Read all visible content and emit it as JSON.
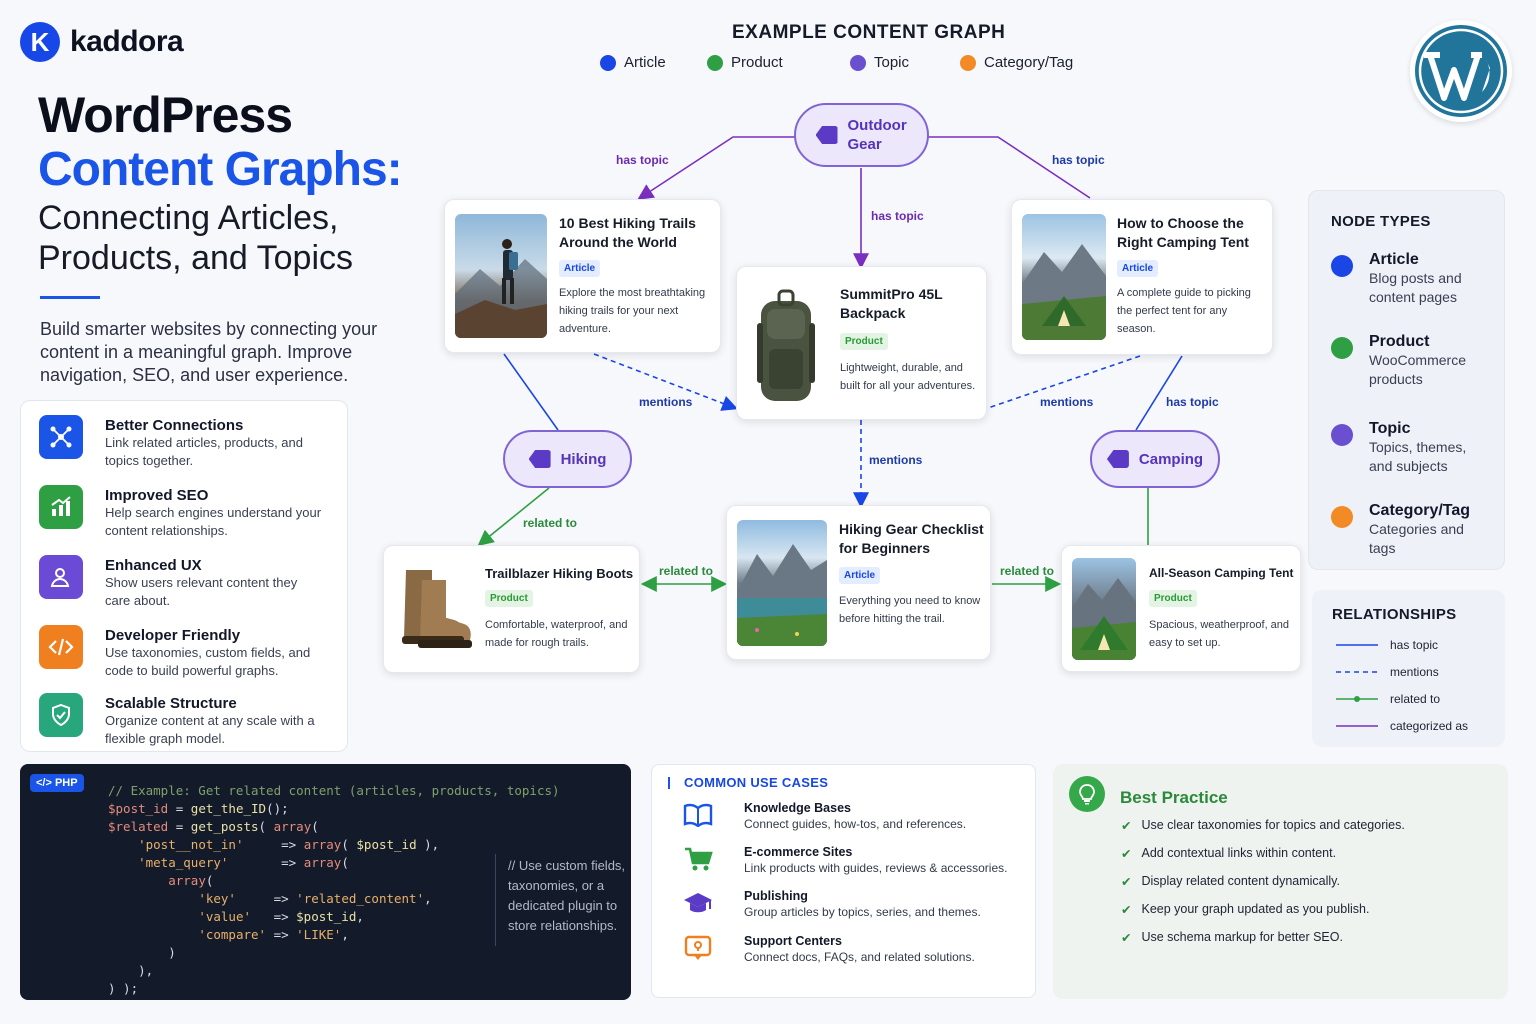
{
  "brand": {
    "name": "kaddora",
    "mark": "K"
  },
  "hero": {
    "line1": "WordPress",
    "line2": "Content Graphs:",
    "line3": "Connecting Articles, Products, and Topics",
    "intro": "Build smarter websites by connecting your content in a meaningful graph. Improve navigation, SEO, and user experience."
  },
  "features": [
    {
      "title": "Better Connections",
      "desc": "Link related articles, products, and topics together.",
      "color": "#1a55e8",
      "icon": "network-icon"
    },
    {
      "title": "Improved SEO",
      "desc": "Help search engines understand your content relationships.",
      "color": "#2ea043",
      "icon": "chart-up-icon"
    },
    {
      "title": "Enhanced UX",
      "desc": "Show users relevant content they care about.",
      "color": "#6b4bd6",
      "icon": "user-icon"
    },
    {
      "title": "Developer Friendly",
      "desc": "Use taxonomies, custom fields, and code to build powerful graphs.",
      "color": "#f0801f",
      "icon": "code-icon"
    },
    {
      "title": "Scalable Structure",
      "desc": "Organize content at any scale with a flexible graph model.",
      "color": "#28a77c",
      "icon": "shield-icon"
    }
  ],
  "graph": {
    "title": "EXAMPLE CONTENT GRAPH",
    "legend": [
      {
        "label": "Article",
        "color": "#1a46e6"
      },
      {
        "label": "Product",
        "color": "#2ea043"
      },
      {
        "label": "Topic",
        "color": "#6a4fd0"
      },
      {
        "label": "Category/Tag",
        "color": "#f28a26"
      }
    ],
    "topics": {
      "outdoor": "Outdoor Gear",
      "hiking": "Hiking",
      "camping": "Camping"
    },
    "cards": {
      "trails": {
        "title": "10 Best Hiking Trails Around the World",
        "badge": "Article",
        "desc": "Explore the most breathtaking hiking trails for your next adventure."
      },
      "backpack": {
        "title": "SummitPro 45L Backpack",
        "badge": "Product",
        "desc": "Lightweight, durable, and built for all your adventures."
      },
      "tent_guide": {
        "title": "How to Choose the Right Camping Tent",
        "badge": "Article",
        "desc": "A complete guide to picking the perfect tent for any season."
      },
      "boots": {
        "title": "Trailblazer Hiking Boots",
        "badge": "Product",
        "desc": "Comfortable, waterproof, and made for rough trails."
      },
      "checklist": {
        "title": "Hiking Gear Checklist for Beginners",
        "badge": "Article",
        "desc": "Everything you need to know before hitting the trail."
      },
      "tent": {
        "title": "All-Season Camping Tent",
        "badge": "Product",
        "desc": "Spacious, weatherproof, and easy to set up."
      }
    },
    "edges": {
      "has_topic": "has topic",
      "mentions": "mentions",
      "related_to": "related to"
    }
  },
  "node_types": {
    "heading": "NODE TYPES",
    "items": [
      {
        "title": "Article",
        "desc": "Blog posts and content pages",
        "color": "#1a46e6"
      },
      {
        "title": "Product",
        "desc": "WooCommerce products",
        "color": "#2ea043"
      },
      {
        "title": "Topic",
        "desc": "Topics, themes, and subjects",
        "color": "#6a4fd0"
      },
      {
        "title": "Category/Tag",
        "desc": "Categories and tags",
        "color": "#f28a26"
      }
    ]
  },
  "relationships": {
    "heading": "RELATIONSHIPS",
    "items": [
      "has topic",
      "mentions",
      "related to",
      "categorized as"
    ]
  },
  "code": {
    "lang": "</> PHP",
    "note": "// Use custom fields, taxonomies, or a dedicated plugin to store relationships."
  },
  "use_cases": {
    "heading": "COMMON USE CASES",
    "items": [
      {
        "title": "Knowledge Bases",
        "desc": "Connect guides, how-tos, and references.",
        "icon": "book-icon"
      },
      {
        "title": "E-commerce Sites",
        "desc": "Link products with guides, reviews & accessories.",
        "icon": "cart-icon"
      },
      {
        "title": "Publishing",
        "desc": "Group articles by topics, series, and themes.",
        "icon": "graduation-cap-icon"
      },
      {
        "title": "Support Centers",
        "desc": "Connect docs, FAQs, and related solutions.",
        "icon": "support-icon"
      }
    ]
  },
  "best_practice": {
    "heading": "Best Practice",
    "items": [
      "Use clear taxonomies for topics and categories.",
      "Add contextual links within content.",
      "Display related content dynamically.",
      "Keep your graph updated as you publish.",
      "Use schema markup for better SEO."
    ]
  }
}
